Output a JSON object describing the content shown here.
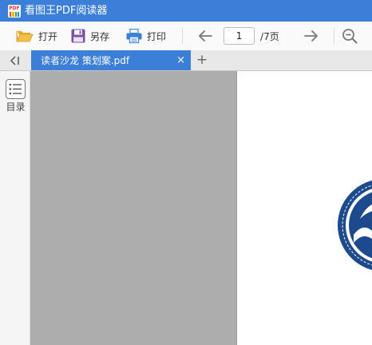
{
  "window": {
    "title": "看图王PDF阅读器",
    "logo_text": "PDF",
    "logo_colors": [
      "#e8453c",
      "#f7b500",
      "#34a853",
      "#3c7fd8"
    ]
  },
  "toolbar": {
    "open_label": "打开",
    "saveas_label": "另存",
    "print_label": "打印",
    "current_page": "1",
    "page_total": "/7页",
    "open_icon": "folder-open-icon",
    "saveas_icon": "floppy-disk-icon",
    "print_icon": "printer-icon",
    "prev_icon": "arrow-left-icon",
    "next_icon": "arrow-right-icon",
    "zoom_icon": "zoom-out-icon"
  },
  "tabs": {
    "items": [
      {
        "title": "读者沙龙 策划案.pdf",
        "close": "×",
        "active": true
      }
    ],
    "new_tab": "+",
    "collapse_icon": "collapse-sidebar-icon"
  },
  "sidebar": {
    "toc_label": "目录",
    "toc_icon": "list-icon"
  },
  "colors": {
    "accent": "#3c7fd8",
    "viewer_bg": "#adadad",
    "emblem_blue": "#1c4a8c"
  }
}
